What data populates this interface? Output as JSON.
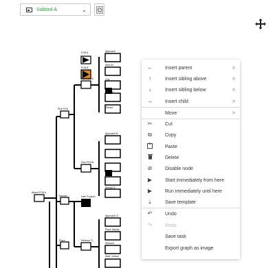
{
  "toolbar": {
    "subtool_label": "Subtool A",
    "subtool_color": "#2e9a3a"
  },
  "tree": {
    "labels": {
      "pcb_a": "PCB A",
      "pcb_b": "PCB B",
      "pick_pcb_a": "Pick PCB A",
      "pick_pcb": "Pick PCB",
      "approach": "Approach",
      "wait_for_fine": "Wait for",
      "grip": "Grip",
      "retract": "Retract",
      "approach_b": "Approach B",
      "wait_for_b": "Wait for",
      "pick_pcb_b": "Pick PCB B",
      "retract_b": "Retract B",
      "attach_pcb": "Attach PCB A",
      "transfer": "Transfer",
      "safe_position": "Safe Position",
      "approach_cl": "Approach Cl",
      "place": "Place",
      "place_display": "Place display",
      "release_tl": "Release TL",
      "release": "Release",
      "retract_to": "Wait / retract"
    }
  },
  "context_menu": {
    "items": [
      {
        "icon": "←",
        "label": "Insert parent",
        "submenu": true
      },
      {
        "icon": "↑",
        "label": "Insert sibling above",
        "submenu": true
      },
      {
        "icon": "↓",
        "label": "Insert sibling below",
        "submenu": true
      },
      {
        "icon": "→",
        "label": "Insert child",
        "submenu": true
      },
      {
        "icon": "",
        "label": "Move",
        "submenu": true
      },
      {
        "icon": "✂",
        "label": "Cut"
      },
      {
        "icon": "⧉",
        "label": "Copy"
      },
      {
        "icon": "📋",
        "label": "Paste"
      },
      {
        "icon": "🗑",
        "label": "Delete"
      },
      {
        "icon": "⊘",
        "label": "Disable node"
      },
      {
        "icon": "▶",
        "label": "Start immediately from here"
      },
      {
        "icon": "▶",
        "label": "Run immediately until here"
      },
      {
        "icon": "⤓",
        "label": "Save template"
      },
      {
        "icon": "↶",
        "label": "Undo"
      },
      {
        "icon": "↷",
        "label": "Redo",
        "disabled": true
      },
      {
        "icon": "",
        "label": "Save task"
      },
      {
        "icon": "",
        "label": "Export graph as image"
      }
    ]
  }
}
